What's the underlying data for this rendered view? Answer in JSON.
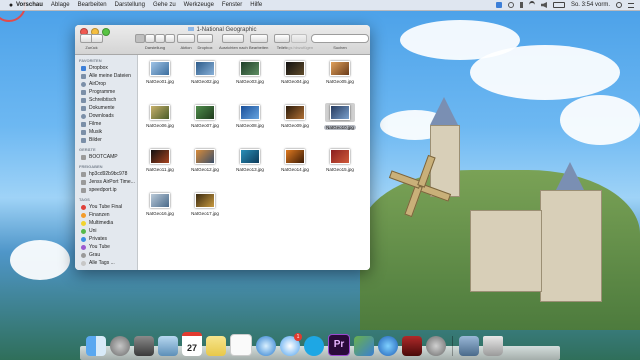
{
  "menubar": {
    "apple": "",
    "app_name": "Vorschau",
    "items": [
      "Ablage",
      "Bearbeiten",
      "Darstellung",
      "Gehe zu",
      "Werkzeuge",
      "Fenster",
      "Hilfe"
    ],
    "clock": "So. 3:54 vorm."
  },
  "window": {
    "title": "1-National Geographic",
    "toolbar": {
      "back_forward": "Zurück",
      "view": "Darstellung",
      "action": "Aktion",
      "dropbox": "Dropbox",
      "arrange": "Ausrichten nach",
      "edit": "Bearbeiten",
      "share": "Teilen",
      "tags": "Tags hinzufügen",
      "search": "Suchen"
    }
  },
  "sidebar": {
    "favorites_header": "FAVORITEN",
    "favorites": [
      "Dropbox",
      "Alle meine Dateien",
      "AirDrop",
      "Programme",
      "Schreibtisch",
      "Dokumente",
      "Downloads",
      "Filme",
      "Musik",
      "Bilder"
    ],
    "devices_header": "GERÄTE",
    "devices": [
      "BOOTCAMP"
    ],
    "shared_header": "FREIGABEN",
    "shared": [
      "hp3cd92b9bc978",
      "Jenss AirPort Time...",
      "speedport.ip"
    ],
    "tags_header": "TAGS",
    "tags": [
      {
        "label": "You Tube Final",
        "color": "#e0413a"
      },
      {
        "label": "Finanzen",
        "color": "#f39c2b"
      },
      {
        "label": "Multimedia",
        "color": "#f2d32f"
      },
      {
        "label": "Uni",
        "color": "#55b94a"
      },
      {
        "label": "Privates",
        "color": "#3b8fe3"
      },
      {
        "label": "You Tube",
        "color": "#9b59d0"
      },
      {
        "label": "Grau",
        "color": "#9a9a9a"
      },
      {
        "label": "Alle Tags ...",
        "color": "#c7c7c7"
      }
    ]
  },
  "files": [
    {
      "name": "NatGeo01.jpg",
      "selected": false
    },
    {
      "name": "NatGeo02.jpg",
      "selected": false
    },
    {
      "name": "NatGeo03.jpg",
      "selected": false
    },
    {
      "name": "NatGeo04.jpg",
      "selected": false
    },
    {
      "name": "NatGeo05.jpg",
      "selected": false
    },
    {
      "name": "NatGeo06.jpg",
      "selected": false
    },
    {
      "name": "NatGeo07.jpg",
      "selected": false
    },
    {
      "name": "NatGeo08.jpg",
      "selected": false
    },
    {
      "name": "NatGeo09.jpg",
      "selected": false
    },
    {
      "name": "NatGeo10.jpg",
      "selected": true
    },
    {
      "name": "NatGeo11.jpg",
      "selected": false
    },
    {
      "name": "NatGeo12.jpg",
      "selected": false
    },
    {
      "name": "NatGeo13.jpg",
      "selected": false
    },
    {
      "name": "NatGeo14.jpg",
      "selected": false
    },
    {
      "name": "NatGeo15.jpg",
      "selected": false
    },
    {
      "name": "NatGeo16.jpg",
      "selected": false
    },
    {
      "name": "NatGeo17.jpg",
      "selected": false
    }
  ],
  "dock": {
    "calendar_day": "27",
    "premiere_label": "Pr",
    "messages_badge": "1"
  }
}
